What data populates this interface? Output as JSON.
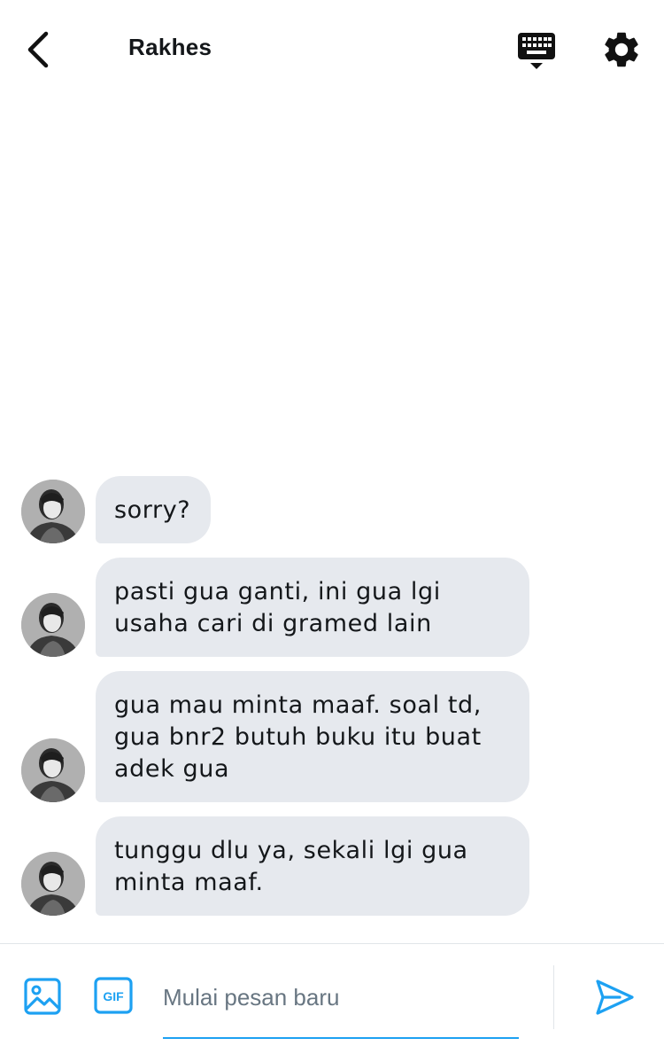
{
  "header": {
    "title": "Rakhes"
  },
  "colors": {
    "accent": "#1da1f2",
    "bubble_bg": "#e6e9ee",
    "text": "#14171a",
    "placeholder": "#687682"
  },
  "icons": {
    "back": "chevron-left-icon",
    "keyboard": "keyboard-icon",
    "settings": "gear-icon",
    "media": "image-icon",
    "gif": "gif-icon",
    "send": "send-icon"
  },
  "messages": [
    {
      "lines": [
        "sorry?"
      ]
    },
    {
      "lines": [
        "pasti gua ganti, ini gua lgi",
        "usaha cari di gramed lain"
      ]
    },
    {
      "lines": [
        "gua mau minta maaf. soal td,",
        "gua bnr2 butuh buku itu buat",
        "adek gua"
      ]
    },
    {
      "lines": [
        "tunggu dlu ya, sekali lgi gua",
        "minta maaf."
      ]
    }
  ],
  "composer": {
    "placeholder": "Mulai pesan baru",
    "value": "",
    "gif_label": "GIF"
  }
}
